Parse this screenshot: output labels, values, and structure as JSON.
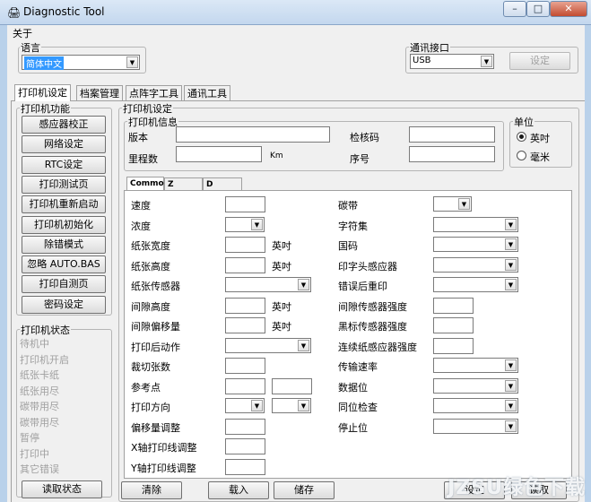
{
  "window": {
    "title": "Diagnostic Tool",
    "icon": "printer-icon",
    "min": "–",
    "max": "□",
    "close": "✕"
  },
  "menu": {
    "about": "关于"
  },
  "language": {
    "label": "语言",
    "value": "简体中文"
  },
  "port": {
    "label": "通讯接口",
    "value": "USB",
    "set_button": "设定"
  },
  "tabs": [
    "打印机设定",
    "档案管理",
    "点阵字工具",
    "通讯工具"
  ],
  "functions": {
    "label": "打印机功能",
    "buttons": [
      "感应器校正",
      "网络设定",
      "RTC设定",
      "打印测试页",
      "打印机重新启动",
      "打印机初始化",
      "除错模式",
      "忽略 AUTO.BAS",
      "打印自测页",
      "密码设定"
    ]
  },
  "status": {
    "label": "打印机状态",
    "items": [
      "待机中",
      "打印机开启",
      "纸张卡纸",
      "纸张用尽",
      "碳带用尽",
      "碳带用尽",
      "暂停",
      "打印中",
      "其它错误"
    ],
    "read_button": "读取状态"
  },
  "settings": {
    "label": "打印机设定"
  },
  "info": {
    "label": "打印机信息",
    "version": "版本",
    "checksum": "检核码",
    "mileage": "里程数",
    "km": "Km",
    "serial": "序号"
  },
  "unit": {
    "label": "单位",
    "inch": "英吋",
    "mm": "毫米",
    "selected": "inch"
  },
  "subtabs": [
    "Common",
    "Z",
    "D"
  ],
  "left_fields": {
    "speed": "速度",
    "density": "浓度",
    "paper_width": "纸张宽度",
    "paper_height": "纸张高度",
    "media_sensor": "纸张传感器",
    "gap_height": "间隙高度",
    "gap_offset": "间隙偏移量",
    "post_print": "打印后动作",
    "cut_count": "裁切张数",
    "ref_point": "参考点",
    "direction": "打印方向",
    "offset_adjust": "偏移量调整",
    "x_adjust": "X轴打印线调整",
    "y_adjust": "Y轴打印线调整",
    "inch": "英吋"
  },
  "right_fields": {
    "ribbon": "碳带",
    "charset": "字符集",
    "country": "国码",
    "head_sensor": "印字头感应器",
    "reprint": "错误后重印",
    "gap_sensitivity": "间隙传感器强度",
    "bline_sensitivity": "黑标传感器强度",
    "cont_sensitivity": "连续纸感应器强度",
    "baud": "传输速率",
    "data_bits": "数据位",
    "parity": "同位检查",
    "stop_bits": "停止位"
  },
  "bottom_buttons": {
    "clear": "清除",
    "load": "载入",
    "save": "储存",
    "set": "设定",
    "read": "读取"
  },
  "watermark": "JZSU绿色下载"
}
